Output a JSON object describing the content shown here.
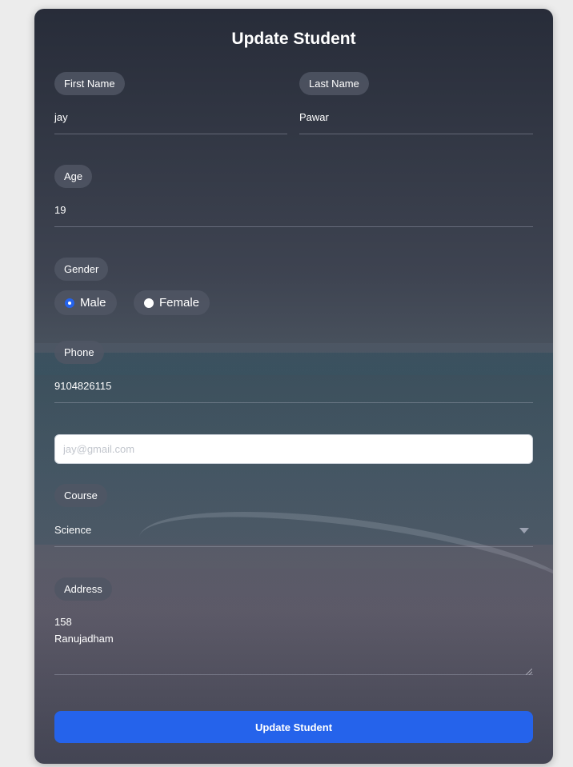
{
  "form": {
    "title": "Update Student",
    "first_name": {
      "label": "First Name",
      "value": "jay"
    },
    "last_name": {
      "label": "Last Name",
      "value": "Pawar"
    },
    "age": {
      "label": "Age",
      "value": "19"
    },
    "gender": {
      "label": "Gender",
      "options": [
        {
          "label": "Male",
          "checked": true
        },
        {
          "label": "Female",
          "checked": false
        }
      ]
    },
    "phone": {
      "label": "Phone",
      "value": "9104826115"
    },
    "email": {
      "placeholder": "jay@gmail.com",
      "value": ""
    },
    "course": {
      "label": "Course",
      "value": "Science"
    },
    "address": {
      "label": "Address",
      "value": "158\nRanujadham"
    },
    "submit_label": "Update Student"
  },
  "colors": {
    "accent": "#2563eb",
    "label_pill": "#50566A",
    "card": "#212633"
  }
}
